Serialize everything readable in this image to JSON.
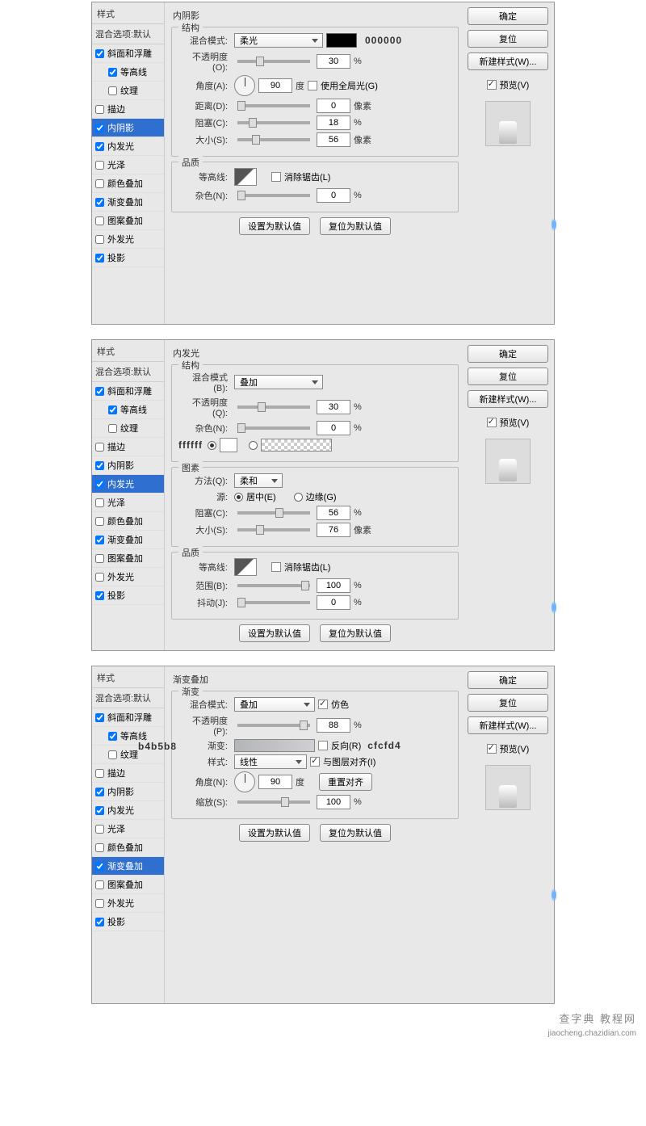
{
  "sidebar": {
    "header": "样式",
    "blending": "混合选项:默认",
    "items": [
      {
        "label": "斜面和浮雕",
        "checked": true,
        "indent": false
      },
      {
        "label": "等高线",
        "checked": true,
        "indent": true
      },
      {
        "label": "纹理",
        "checked": false,
        "indent": true
      },
      {
        "label": "描边",
        "checked": false,
        "indent": false
      },
      {
        "label": "内阴影",
        "checked": true,
        "indent": false
      },
      {
        "label": "内发光",
        "checked": true,
        "indent": false
      },
      {
        "label": "光泽",
        "checked": false,
        "indent": false
      },
      {
        "label": "颜色叠加",
        "checked": false,
        "indent": false
      },
      {
        "label": "渐变叠加",
        "checked": true,
        "indent": false
      },
      {
        "label": "图案叠加",
        "checked": false,
        "indent": false
      },
      {
        "label": "外发光",
        "checked": false,
        "indent": false
      },
      {
        "label": "投影",
        "checked": true,
        "indent": false
      }
    ]
  },
  "right": {
    "ok": "确定",
    "reset": "复位",
    "newstyle": "新建样式(W)...",
    "preview": "预览(V)"
  },
  "defaults": {
    "set": "设置为默认值",
    "reset": "复位为默认值"
  },
  "panel1": {
    "title": "内阴影",
    "struct": "结构",
    "blend_label": "混合模式:",
    "blend_value": "柔光",
    "color_annot": "000000",
    "opacity_label": "不透明度(O):",
    "opacity": "30",
    "opacity_unit": "%",
    "angle_label": "角度(A):",
    "angle": "90",
    "angle_unit": "度",
    "global": "使用全局光(G)",
    "distance_label": "距离(D):",
    "distance": "0",
    "distance_unit": "像素",
    "choke_label": "阻塞(C):",
    "choke": "18",
    "choke_unit": "%",
    "size_label": "大小(S):",
    "size": "56",
    "size_unit": "像素",
    "quality": "品质",
    "contour_label": "等高线:",
    "antialias": "消除锯齿(L)",
    "noise_label": "杂色(N):",
    "noise": "0",
    "noise_unit": "%"
  },
  "panel2": {
    "title": "内发光",
    "struct": "结构",
    "blend_label": "混合模式(B):",
    "blend_value": "叠加",
    "opacity_label": "不透明度(Q):",
    "opacity": "30",
    "opacity_unit": "%",
    "noise_label": "杂色(N):",
    "noise": "0",
    "noise_unit": "%",
    "color_annot": "ffffff",
    "elements": "图素",
    "technique_label": "方法(Q):",
    "technique_value": "柔和",
    "source_label": "源:",
    "source_center": "居中(E)",
    "source_edge": "边缘(G)",
    "choke_label": "阻塞(C):",
    "choke": "56",
    "choke_unit": "%",
    "size_label": "大小(S):",
    "size": "76",
    "size_unit": "像素",
    "quality": "品质",
    "contour_label": "等高线:",
    "antialias": "消除锯齿(L)",
    "range_label": "范围(B):",
    "range": "100",
    "range_unit": "%",
    "jitter_label": "抖动(J):",
    "jitter": "0",
    "jitter_unit": "%"
  },
  "panel3": {
    "title": "渐变叠加",
    "gradient": "渐变",
    "blend_label": "混合模式:",
    "blend_value": "叠加",
    "dither": "仿色",
    "opacity_label": "不透明度(P):",
    "opacity": "88",
    "opacity_unit": "%",
    "grad_label": "渐变:",
    "reverse": "反向(R)",
    "annot_left": "b4b5b8",
    "annot_right": "cfcfd4",
    "style_label": "样式:",
    "style_value": "线性",
    "align": "与图层对齐(I)",
    "angle_label": "角度(N):",
    "angle": "90",
    "angle_unit": "度",
    "reset_align": "重置对齐",
    "scale_label": "缩放(S):",
    "scale": "100",
    "scale_unit": "%"
  },
  "watermark": "查字典 教程网",
  "watermark_url": "jiaocheng.chazidian.com"
}
